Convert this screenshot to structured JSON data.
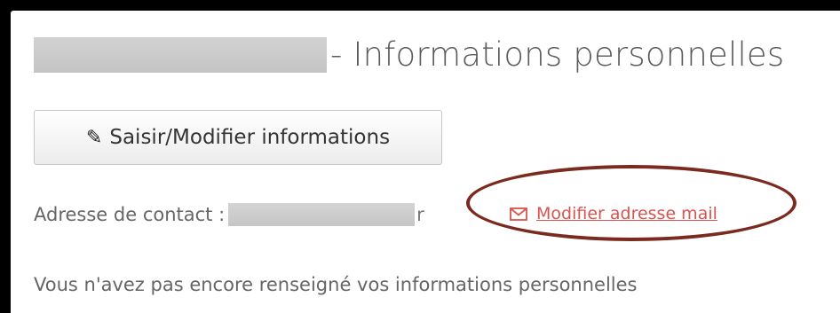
{
  "header": {
    "title_suffix": "- Informations personnelles"
  },
  "actions": {
    "edit_button_label": "Saisir/Modifier informations"
  },
  "contact": {
    "label": "Adresse de contact :",
    "visible_tail": "r",
    "modify_mail_label": "Modifier adresse mail"
  },
  "notice": {
    "text": "Vous n'avez pas encore renseigné vos informations personnelles"
  },
  "colors": {
    "link": "#d9534f",
    "annotation": "#7a2a1e",
    "text": "#666666"
  },
  "icons": {
    "edit": "pencil-icon",
    "mail": "envelope-icon"
  }
}
